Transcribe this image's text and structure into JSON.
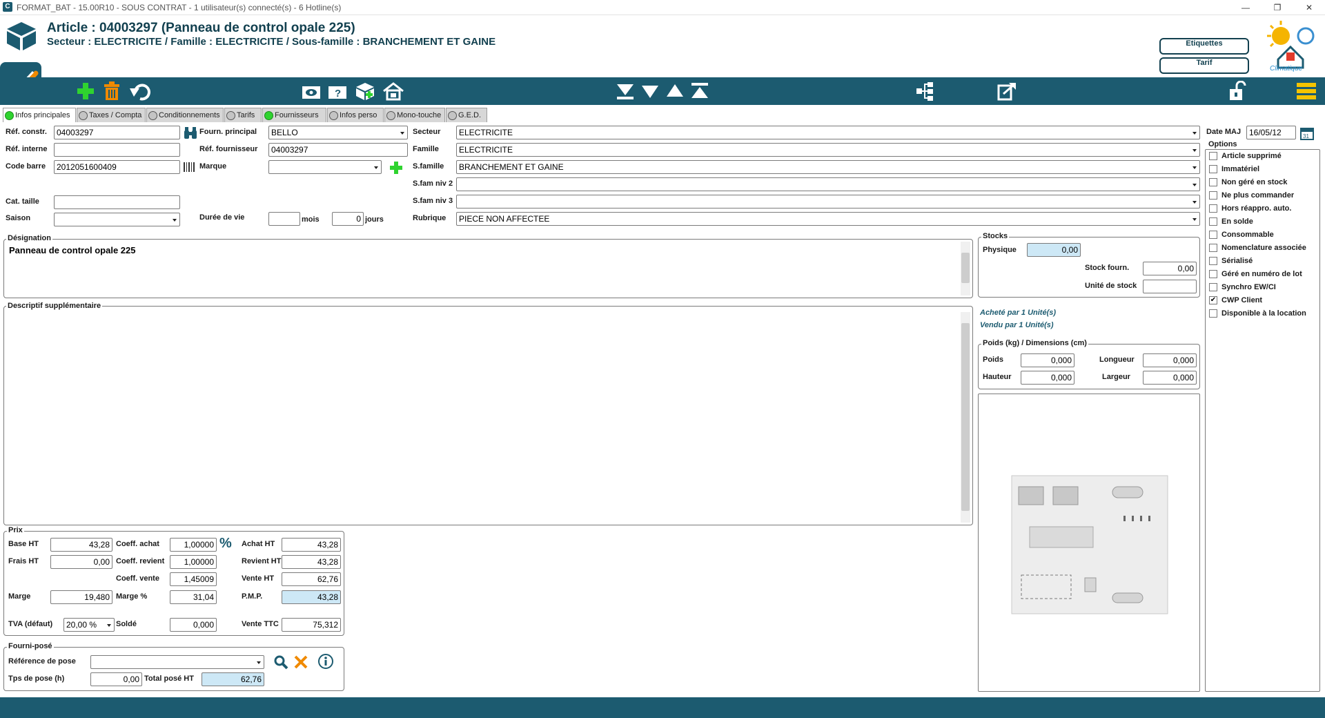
{
  "window": {
    "title": "FORMAT_BAT - 15.00R10 - SOUS CONTRAT - 1 utilisateur(s) connecté(s) - 6 Hotline(s)"
  },
  "header": {
    "title": "Article : 04003297 (Panneau de control opale 225)",
    "subtitle": "Secteur : ELECTRICITE / Famille : ELECTRICITE / Sous-famille : BRANCHEMENT ET GAINE",
    "btn_etiquettes": "Etiquettes",
    "btn_tarif": "Tarif",
    "logo_text": "Climatique"
  },
  "tabs": [
    {
      "label": "Infos principales",
      "dot": "green"
    },
    {
      "label": "Taxes / Compta",
      "dot": "grey"
    },
    {
      "label": "Conditionnements",
      "dot": "grey"
    },
    {
      "label": "Tarifs",
      "dot": "grey"
    },
    {
      "label": "Fournisseurs",
      "dot": "green"
    },
    {
      "label": "Infos perso",
      "dot": "grey"
    },
    {
      "label": "Mono-touche",
      "dot": "grey"
    },
    {
      "label": "G.E.D.",
      "dot": "grey"
    }
  ],
  "form": {
    "ref_constr_label": "Réf. constr.",
    "ref_constr": "04003297",
    "ref_interne_label": "Réf. interne",
    "ref_interne": "",
    "code_barre_label": "Code barre",
    "code_barre": "2012051600409",
    "cat_taille_label": "Cat. taille",
    "cat_taille": "",
    "saison_label": "Saison",
    "saison": "",
    "fourn_principal_label": "Fourn. principal",
    "fourn_principal": "BELLO",
    "ref_fournisseur_label": "Réf. fournisseur",
    "ref_fournisseur": "04003297",
    "marque_label": "Marque",
    "marque": "",
    "duree_vie_label": "Durée de vie",
    "duree_mois": "",
    "mois_label": "mois",
    "duree_jours": "0",
    "jours_label": "jours",
    "secteur_label": "Secteur",
    "secteur": "ELECTRICITE",
    "famille_label": "Famille",
    "famille": "ELECTRICITE",
    "sfamille_label": "S.famille",
    "sfamille": "BRANCHEMENT ET GAINE",
    "sfam2_label": "S.fam niv 2",
    "sfam2": "",
    "sfam3_label": "S.fam niv 3",
    "sfam3": "",
    "rubrique_label": "Rubrique",
    "rubrique": "PIECE NON AFFECTEE",
    "date_maj_label": "Date MAJ",
    "date_maj": "16/05/12"
  },
  "designation": {
    "label": "Désignation",
    "value": "Panneau de control opale 225"
  },
  "descriptif": {
    "label": "Descriptif supplémentaire",
    "value": ""
  },
  "stocks": {
    "label": "Stocks",
    "physique_label": "Physique",
    "physique": "0,00",
    "stock_fourn_label": "Stock fourn.",
    "stock_fourn": "0,00",
    "unite_stock_label": "Unité de stock",
    "unite_stock": "",
    "achete": "Acheté par 1 Unité(s)",
    "vendu": "Vendu par 1 Unité(s)"
  },
  "poids": {
    "label": "Poids (kg) / Dimensions (cm)",
    "poids_label": "Poids",
    "poids": "0,000",
    "longueur_label": "Longueur",
    "longueur": "0,000",
    "hauteur_label": "Hauteur",
    "hauteur": "0,000",
    "largeur_label": "Largeur",
    "largeur": "0,000"
  },
  "options": {
    "label": "Options",
    "items": [
      {
        "label": "Article supprimé",
        "checked": ""
      },
      {
        "label": "Immatériel",
        "checked": ""
      },
      {
        "label": "Non géré en stock",
        "checked": ""
      },
      {
        "label": "Ne plus commander",
        "checked": ""
      },
      {
        "label": "Hors réappro. auto.",
        "checked": ""
      },
      {
        "label": "En solde",
        "checked": ""
      },
      {
        "label": "Consommable",
        "checked": ""
      },
      {
        "label": "Nomenclature associée",
        "checked": ""
      },
      {
        "label": "Sérialisé",
        "checked": ""
      },
      {
        "label": "Géré en numéro de lot",
        "checked": ""
      },
      {
        "label": "Synchro EW/CI",
        "checked": ""
      },
      {
        "label": "CWP Client",
        "checked": "✔"
      },
      {
        "label": "Disponible à la location",
        "checked": ""
      }
    ]
  },
  "prix": {
    "label": "Prix",
    "base_ht_label": "Base HT",
    "base_ht": "43,28",
    "frais_ht_label": "Frais HT",
    "frais_ht": "0,00",
    "marge_label": "Marge",
    "marge": "19,480",
    "tva_label": "TVA (défaut)",
    "tva": "20,00 %",
    "coeff_achat_label": "Coeff. achat",
    "coeff_achat": "1,00000",
    "percent_label": "%",
    "coeff_revient_label": "Coeff. revient",
    "coeff_revient": "1,00000",
    "coeff_vente_label": "Coeff. vente",
    "coeff_vente": "1,45009",
    "marge_pct_label": "Marge %",
    "marge_pct": "31,04",
    "solde_label": "Soldé",
    "solde": "0,000",
    "achat_ht_label": "Achat HT",
    "achat_ht": "43,28",
    "revient_ht_label": "Revient HT",
    "revient_ht": "43,28",
    "vente_ht_label": "Vente HT",
    "vente_ht": "62,76",
    "pmp_label": "P.M.P.",
    "pmp": "43,28",
    "vente_ttc_label": "Vente TTC",
    "vente_ttc": "75,312"
  },
  "fourni_pose": {
    "label": "Fourni-posé",
    "ref_pose_label": "Référence de pose",
    "ref_pose": "",
    "tps_pose_label": "Tps de pose (h)",
    "tps_pose": "0,00",
    "total_pose_label": "Total posé HT",
    "total_pose": "62,76"
  },
  "colors": {
    "brand": "#1c5b70",
    "title": "#12404f",
    "green": "#2fd32f",
    "readonly": "#cde8f6",
    "orange": "#f08a00"
  }
}
